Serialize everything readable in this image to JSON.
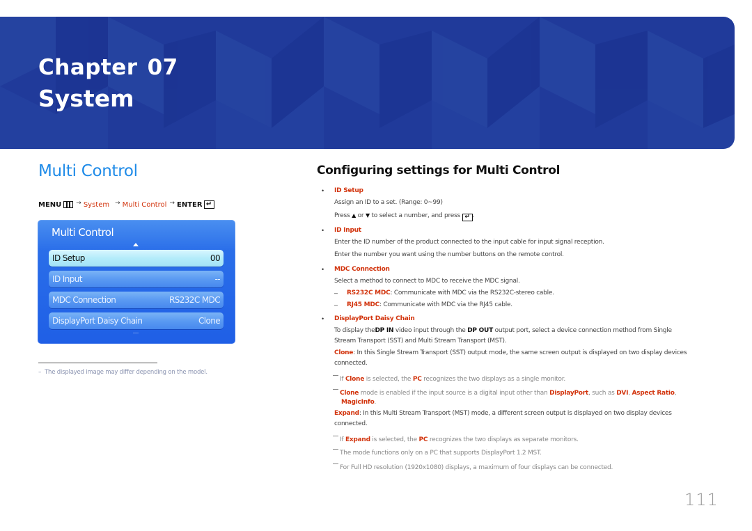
{
  "banner": {
    "chapter_label": "Chapter",
    "chapter_number": "07",
    "title": "System",
    "color": "#203a9a"
  },
  "left": {
    "section_title": "Multi Control",
    "breadcrumb": {
      "menu": "MENU",
      "menu_icon": "menu-icon",
      "arrow": "→",
      "step1": "System",
      "step2": "Multi Control",
      "enter": "ENTER",
      "enter_icon": "enter-icon"
    },
    "osd": {
      "title": "Multi Control",
      "rows": [
        {
          "label": "ID Setup",
          "value": "00",
          "selected": true
        },
        {
          "label": "ID Input",
          "value": "--",
          "selected": false
        },
        {
          "label": "MDC Connection",
          "value": "RS232C MDC",
          "selected": false
        },
        {
          "label": "DisplayPort Daisy Chain",
          "value": "Clone",
          "selected": false
        }
      ]
    },
    "footnote": {
      "dash": "–",
      "text": "The displayed image may differ depending on the model."
    }
  },
  "right": {
    "heading": "Configuring settings for Multi Control",
    "bullet": "•",
    "id_setup": {
      "title": "ID Setup",
      "line1": "Assign an ID to a set. (Range: 0~99)",
      "line2_a": "Press",
      "up": "▲",
      "or": "or",
      "down": "▼",
      "line2_b": "to select a number, and press",
      "enter_glyph": "↵",
      "period": "."
    },
    "id_input": {
      "title": "ID Input",
      "line1": "Enter the ID number of the product connected to the input cable for input signal reception.",
      "line2": "Enter the number you want using the number buttons on the remote control."
    },
    "mdc": {
      "title": "MDC Connection",
      "line1": "Select a method to connect to MDC to receive the MDC signal.",
      "sub_dash": "–",
      "opt1_name": "RS232C MDC",
      "opt1_text": ": Communicate with MDC via the RS232C-stereo cable.",
      "opt2_name": "RJ45 MDC",
      "opt2_text": ": Communicate with MDC via the RJ45 cable."
    },
    "dp": {
      "title": "DisplayPort Daisy Chain",
      "p1_a": "To display the",
      "p1_dpin": "DP IN",
      "p1_b": " video input through the ",
      "p1_dpout": "DP OUT",
      "p1_c": " output port, select a device connection method from Single",
      "p1_line2": "Stream Transport (SST) and Multi Stream Transport (MST).",
      "clone_label": "Clone",
      "clone_text": ": In this Single Stream Transport (SST) output mode, the same screen output is displayed on two display devices",
      "clone_line2": "connected.",
      "note1_a": "If ",
      "note1_clone": "Clone",
      "note1_b": " is selected, the ",
      "note1_pc": "PC",
      "note1_c": " recognizes the two displays as a single monitor.",
      "note2_clone": "Clone",
      "note2_a": " mode is enabled if the input source is a digital input other than ",
      "note2_dp": "DisplayPort",
      "note2_b": ", such as ",
      "note2_dvi": "DVI",
      "note2_sep": ", ",
      "note2_ar": "Aspect Ratio",
      "note2_sep2": ",",
      "note2_magic": "MagicInfo",
      "note2_end": ".",
      "expand_label": "Expand",
      "expand_text": ": In this Multi Stream Transport (MST) mode, a different screen output is displayed on two display devices",
      "expand_line2": "connected.",
      "note3_a": "If ",
      "note3_expand": "Expand",
      "note3_b": " is selected, the ",
      "note3_pc": "PC",
      "note3_c": " recognizes the two displays as separate monitors.",
      "note4": "The mode functions only on a PC that supports DisplayPort 1.2 MST.",
      "note5": "For Full HD resolution (1920x1080) displays, a maximum of four displays can be connected."
    }
  },
  "page_number": "111",
  "colors": {
    "accent_red": "#d2330c",
    "accent_blue": "#1f8be8",
    "osd_blue": "#2a6ee9"
  }
}
